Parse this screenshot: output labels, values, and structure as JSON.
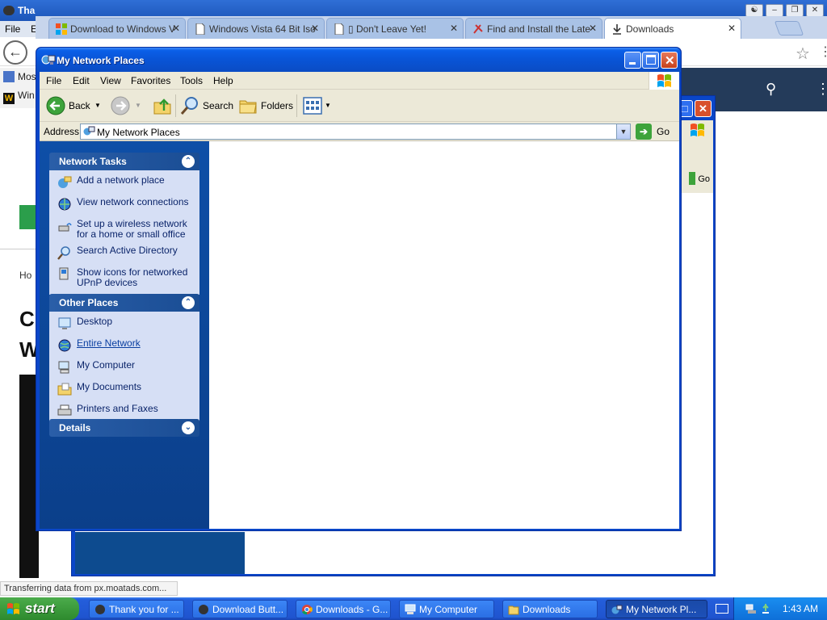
{
  "background_browser": {
    "window_title": "Tha",
    "menu": [
      "File",
      "E"
    ],
    "tabs": [
      {
        "label": "Download to Windows V",
        "active": false
      },
      {
        "label": "Windows Vista 64 Bit Iso",
        "active": false
      },
      {
        "label": "▯ Don't Leave Yet!",
        "active": false
      },
      {
        "label": "Find and Install the Late",
        "active": false
      },
      {
        "label": "Downloads",
        "active": true
      }
    ],
    "bookmarks": [
      "Mos",
      "Win"
    ],
    "page": {
      "breadcrumb": "Ho",
      "heading_line1": "C",
      "heading_line2": "W"
    },
    "status_text": "Transferring data from px.moatads.com..."
  },
  "second_window": {
    "go_label": "Go"
  },
  "explorer": {
    "title": "My Network Places",
    "menu": [
      "File",
      "Edit",
      "View",
      "Favorites",
      "Tools",
      "Help"
    ],
    "toolbar": {
      "back": "Back",
      "search": "Search",
      "folders": "Folders"
    },
    "address": {
      "label": "Address",
      "value": "My Network Places",
      "go": "Go"
    },
    "network_tasks": {
      "title": "Network Tasks",
      "items": [
        {
          "label": "Add a network place",
          "icon": "add-network-place-icon"
        },
        {
          "label": "View network connections",
          "icon": "network-connections-icon"
        },
        {
          "label": "Set up a wireless network for a home or small office",
          "icon": "wireless-icon"
        },
        {
          "label": "Search Active Directory",
          "icon": "active-directory-icon"
        },
        {
          "label": "Show icons for networked UPnP devices",
          "icon": "upnp-icon"
        }
      ]
    },
    "other_places": {
      "title": "Other Places",
      "items": [
        {
          "label": "Desktop",
          "icon": "desktop-icon"
        },
        {
          "label": "Entire Network",
          "icon": "entire-network-icon"
        },
        {
          "label": "My Computer",
          "icon": "my-computer-icon"
        },
        {
          "label": "My Documents",
          "icon": "my-documents-icon"
        },
        {
          "label": "Printers and Faxes",
          "icon": "printers-icon"
        }
      ]
    },
    "details": {
      "title": "Details"
    }
  },
  "taskbar": {
    "start_label": "start",
    "buttons": [
      {
        "label": "Thank you for ...",
        "active": false
      },
      {
        "label": "Download Butt...",
        "active": false
      },
      {
        "label": "Downloads - G...",
        "active": false
      },
      {
        "label": "My Computer",
        "active": false
      },
      {
        "label": "Downloads",
        "active": false
      },
      {
        "label": "My Network Pl...",
        "active": true
      }
    ],
    "clock": "1:43 AM"
  },
  "colors": {
    "xp_blue": "#0a46c8",
    "start_green": "#3c9b3c",
    "task_pane_blue": "#0e4fa7",
    "task_body": "#d6dff5"
  }
}
